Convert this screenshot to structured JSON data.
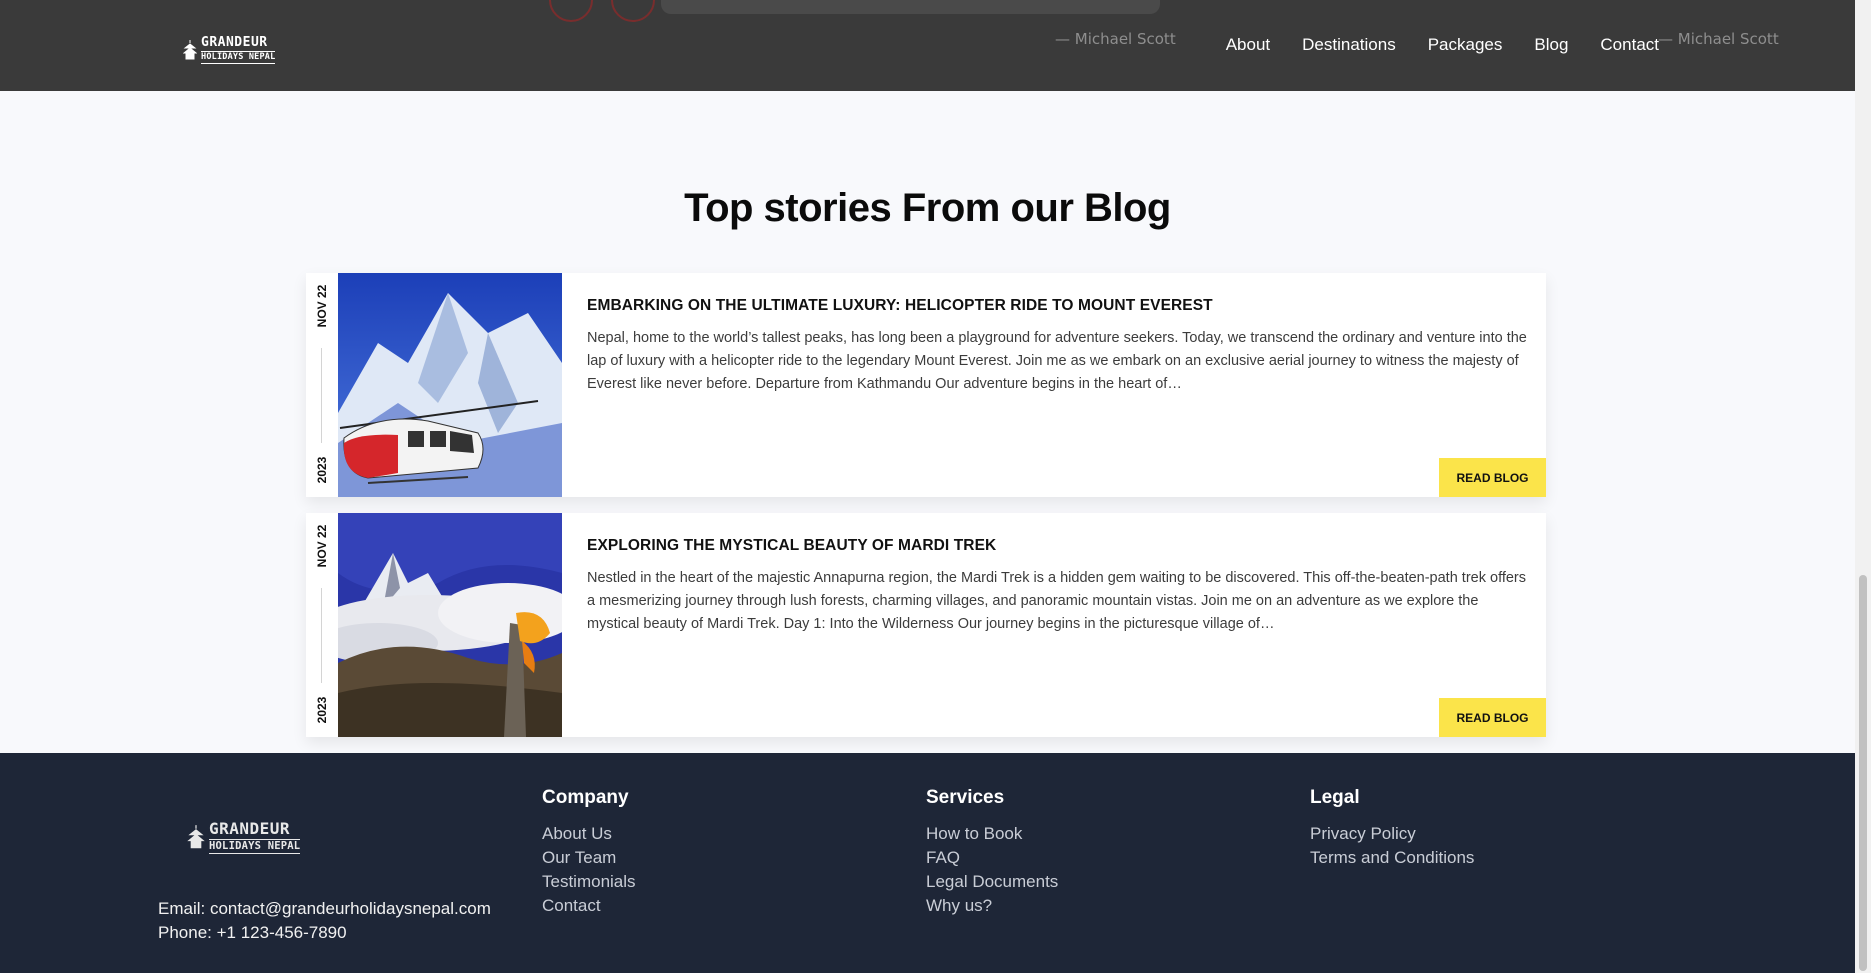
{
  "header": {
    "logo": {
      "line1": "GRANDEUR",
      "line2": "HOLIDAYS NEPAL"
    },
    "ghost_quotes": [
      "— Michael Scott",
      "— Michael Scott"
    ],
    "nav": [
      {
        "label": "About"
      },
      {
        "label": "Destinations"
      },
      {
        "label": "Packages"
      },
      {
        "label": "Blog"
      },
      {
        "label": "Contact"
      }
    ]
  },
  "blog": {
    "title": "Top stories From our Blog",
    "posts": [
      {
        "date_day": "NOV 22",
        "date_year": "2023",
        "title": "EMBARKING ON THE ULTIMATE LUXURY: HELICOPTER RIDE TO MOUNT EVEREST",
        "excerpt": "Nepal, home to the world’s tallest peaks, has long been a playground for adventure seekers. Today, we transcend the ordinary and venture into the lap of luxury with a helicopter ride to the legendary Mount Everest. Join me as we embark on an exclusive aerial journey to witness the majesty of Everest like never before. Departure from Kathmandu Our adventure begins in the heart of…",
        "button": "READ BLOG",
        "image": "helicopter-everest-image"
      },
      {
        "date_day": "NOV 22",
        "date_year": "2023",
        "title": "EXPLORING THE MYSTICAL BEAUTY OF MARDI TREK",
        "excerpt": "  Nestled in the heart of the majestic Annapurna region, the Mardi Trek is a hidden gem waiting to be discovered. This off-the-beaten-path trek offers a mesmerizing journey through lush forests, charming villages, and panoramic mountain vistas. Join me on an adventure as we explore the mystical beauty of Mardi Trek. Day 1: Into the Wilderness Our journey begins in the picturesque village of…",
        "button": "READ BLOG",
        "image": "mardi-trek-image"
      }
    ]
  },
  "footer": {
    "logo": {
      "line1": "GRANDEUR",
      "line2": "HOLIDAYS NEPAL"
    },
    "email": "Email: contact@grandeurholidaysnepal.com",
    "phone": "Phone: +1 123-456-7890",
    "company": {
      "heading": "Company",
      "links": [
        "About Us",
        "Our Team",
        "Testimonials",
        "Contact"
      ]
    },
    "services": {
      "heading": "Services",
      "links": [
        "How to Book",
        "FAQ",
        "Legal Documents",
        "Why us?"
      ]
    },
    "legal": {
      "heading": "Legal",
      "links": [
        "Privacy Policy",
        "Terms and Conditions"
      ]
    }
  },
  "colors": {
    "header_bg": "#3a3a3a",
    "footer_bg": "#1e2637",
    "accent_yellow": "#fbe44a"
  }
}
